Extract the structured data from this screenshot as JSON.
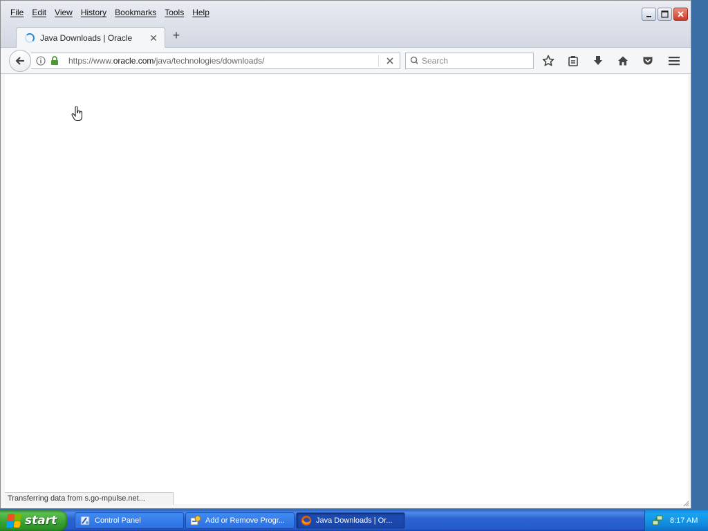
{
  "menubar": {
    "items": [
      "File",
      "Edit",
      "View",
      "History",
      "Bookmarks",
      "Tools",
      "Help"
    ]
  },
  "tab": {
    "title": "Java Downloads | Oracle",
    "icon": "loading-spinner-icon"
  },
  "urlbar": {
    "prefix": "https://www.",
    "host": "oracle.com",
    "path": "/java/technologies/downloads/"
  },
  "search": {
    "placeholder": "Search"
  },
  "status": {
    "text": "Transferring data from s.go-mpulse.net..."
  },
  "taskbar": {
    "start_label": "start",
    "tasks": [
      {
        "label": "Control Panel",
        "icon": "control-panel-icon"
      },
      {
        "label": "Add or Remove Progr...",
        "icon": "add-remove-programs-icon"
      },
      {
        "label": "Java Downloads | Or...",
        "icon": "firefox-icon"
      }
    ],
    "clock": "8:17 AM"
  },
  "colors": {
    "accent": "#2a8ad6",
    "lock_green": "#4a9c2f",
    "taskbar_blue": "#245ccd",
    "start_green": "#36a031"
  }
}
